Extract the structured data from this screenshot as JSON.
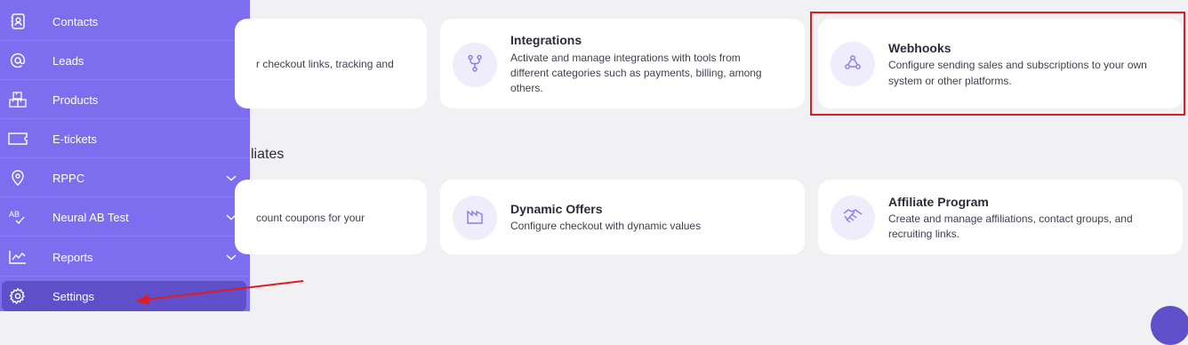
{
  "sidebar": {
    "items": [
      {
        "label": "Contacts",
        "icon": "contacts-icon"
      },
      {
        "label": "Leads",
        "icon": "at-sign-icon"
      },
      {
        "label": "Products",
        "icon": "boxes-icon"
      },
      {
        "label": "E-tickets",
        "icon": "ticket-icon"
      },
      {
        "label": "RPPC",
        "icon": "map-pin-icon"
      },
      {
        "label": "Neural AB Test",
        "icon": "ab-test-icon"
      },
      {
        "label": "Reports",
        "icon": "chart-icon"
      },
      {
        "label": "Settings",
        "icon": "gear-icon"
      }
    ]
  },
  "top_row": {
    "partial_card_text": "r checkout links, tracking and",
    "integrations": {
      "title": "Integrations",
      "desc_line1": "Activate and manage integrations with tools from",
      "desc_line2": "different categories such as payments, billing, among",
      "desc_line3": "others."
    },
    "webhooks": {
      "title": "Webhooks",
      "desc_line1": "Configure sending sales and subscriptions to your own",
      "desc_line2": "system or other platforms."
    }
  },
  "section": {
    "title": "liates"
  },
  "bottom_row": {
    "partial_card_text": "count coupons for your",
    "dynamic_offers": {
      "title": "Dynamic Offers",
      "desc_line1": "Configure checkout with dynamic values"
    },
    "affiliate_program": {
      "title": "Affiliate Program",
      "desc_line1": "Create and manage affiliations, contact groups, and",
      "desc_line2": "recruiting links."
    }
  },
  "colors": {
    "sidebar": "#7d6ef0",
    "sidebar_active": "#5f4fc9",
    "icon_accent": "#8a7bea",
    "annotation_red": "#e01b24"
  }
}
